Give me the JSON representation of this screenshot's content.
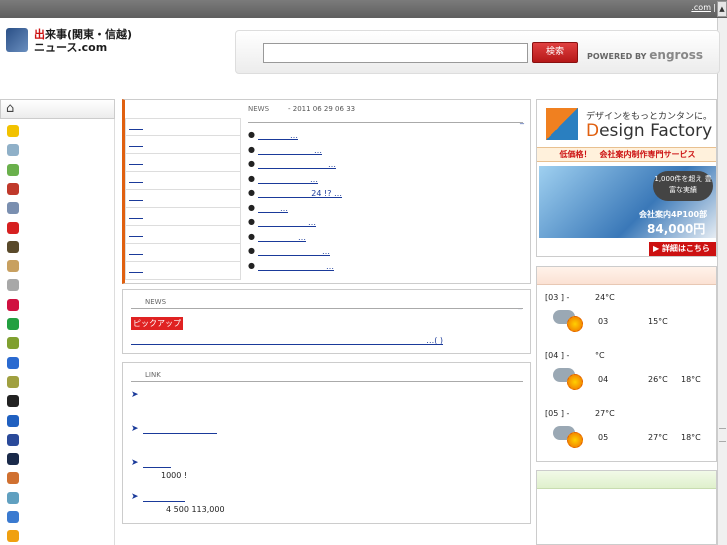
{
  "topbar": {
    "link": ".com",
    "separator": "|",
    "scroll_glyph": "▲"
  },
  "logo": {
    "line1_red": "出",
    "line1_rest": "来事(関東・信越)",
    "line2": "ニュース.com"
  },
  "search": {
    "placeholder": "",
    "value": "",
    "button_label": "検索",
    "powered_prefix": "POWERED BY",
    "powered_brand": "engross"
  },
  "sidebar": {
    "home_glyph": "⌂",
    "category_icon_colors": [
      "#f2c200",
      "#8fb0c8",
      "#6ab04c",
      "#c0392b",
      "#7a8fb0",
      "#d62020",
      "#5a4a2a",
      "#c8a060",
      "#a8a8a8",
      "#d01040",
      "#22a040",
      "#80a030",
      "#2a6ad0",
      "#a0a040",
      "#222222",
      "#2060c0",
      "#2a4a9a",
      "#1a2a4a",
      "#d07030",
      "#60a0c0",
      "#3a7ad0",
      "#f0a010"
    ]
  },
  "news": {
    "label": "NEWS",
    "date": "- 2011 06 29 06 33",
    "more": "_",
    "categories": [
      "",
      "",
      "",
      "",
      "",
      "",
      "",
      "",
      ""
    ],
    "items": [
      "…",
      "…",
      "…",
      "…",
      "24 !?  …",
      "…",
      "…",
      "…",
      "…",
      "…"
    ]
  },
  "pickup": {
    "label": "NEWS",
    "more": "_",
    "badge": "ピックアップ",
    "link": "…(   )"
  },
  "links": {
    "label": "LINK",
    "items": [
      {
        "arrow": "➤",
        "text": "",
        "desc": ""
      },
      {
        "arrow": "➤",
        "text": "",
        "desc": ""
      },
      {
        "arrow": "➤",
        "text": "",
        "desc": "1000   !"
      },
      {
        "arrow": "➤",
        "text": "",
        "desc": "4   500 113,000"
      }
    ]
  },
  "ad": {
    "tagline": "デザインをもっとカンタンに。",
    "brand_first": "D",
    "brand_rest": "esign Factory",
    "strip": "低価格！　会社案内制作専門サービス",
    "bubble": "1,000件を超え 豊富な実績",
    "price_label": "会社案内4P100部",
    "price": "84,000円",
    "button": "▶ 詳細はこちら"
  },
  "weather": {
    "days": [
      {
        "hdr": "[03      ] -",
        "temp_top": "24°C",
        "day": "03",
        "hi": "15°C",
        "lo": ""
      },
      {
        "hdr": "[04      ] -",
        "temp_top": "°C",
        "day": "04",
        "hi": "26°C",
        "lo": "18°C"
      },
      {
        "hdr": "[05      ] -",
        "temp_top": "27°C",
        "day": "05",
        "hi": "27°C",
        "lo": "18°C"
      }
    ]
  }
}
